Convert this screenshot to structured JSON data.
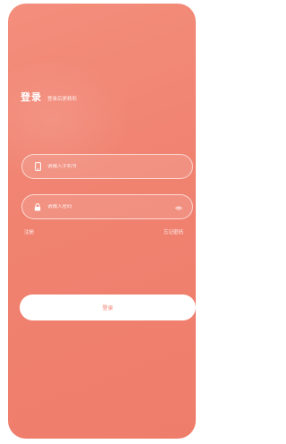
{
  "header": {
    "title": "登录",
    "subtitle": "登录后更精彩"
  },
  "form": {
    "phone": {
      "placeholder": "请输入手机号",
      "value": "",
      "icon": "phone-icon"
    },
    "password": {
      "placeholder": "请输入密码",
      "value": "",
      "icon": "lock-icon",
      "toggle_icon": "eye-icon"
    }
  },
  "links": {
    "register": "注册",
    "forgot": "忘记密码"
  },
  "actions": {
    "login": "登录"
  },
  "colors": {
    "background": "#f08270",
    "accent": "#ee7f6d",
    "button": "#ffffff"
  }
}
